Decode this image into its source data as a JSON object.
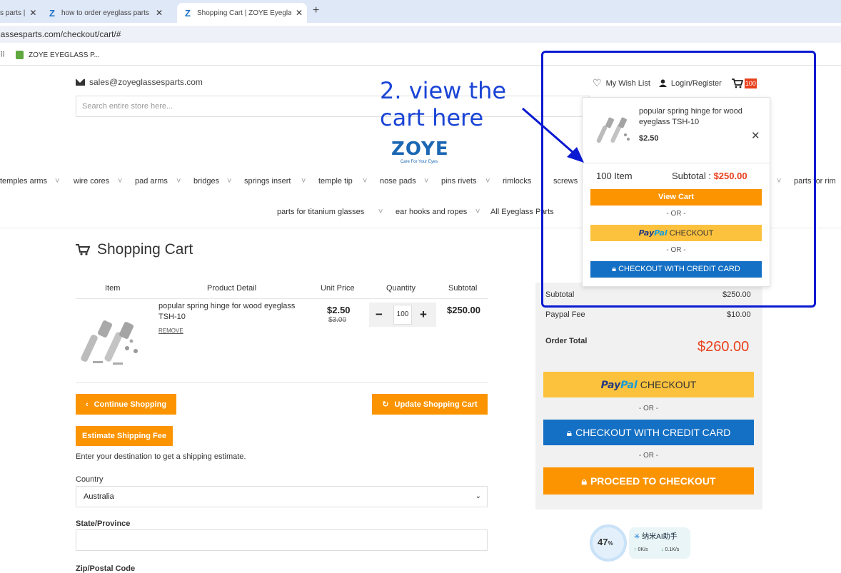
{
  "browser": {
    "tabs": [
      {
        "label": "s parts |"
      },
      {
        "label": "how to order eyeglass parts |"
      },
      {
        "label": "Shopping Cart | ZOYE Eyegla"
      }
    ],
    "url": "lassesparts.com/checkout/cart/#",
    "bookmark_label": "ZOYE EYEGLASS P..."
  },
  "header": {
    "email": "sales@zoyeglassesparts.com",
    "search_placeholder": "Search entire store here...",
    "wishlist": "My Wish List",
    "login": "Login/Register",
    "cart_count": "100",
    "logo_text": "ZOYE",
    "logo_tagline": "Care For Your Eyes"
  },
  "nav": {
    "row1": [
      "temples arms",
      "wire cores",
      "pad arms",
      "bridges",
      "springs insert",
      "temple tip",
      "nose pads",
      "pins rivets",
      "rimlocks",
      "screws",
      "parts for rim"
    ],
    "row2": [
      "parts for titanium glasses",
      "ear hooks and ropes",
      "All Eyeglass Parts"
    ]
  },
  "cart": {
    "title": "Shopping Cart",
    "headers": {
      "item": "Item",
      "detail": "Product Detail",
      "unit_price": "Unit Price",
      "quantity": "Quantity",
      "subtotal": "Subtotal"
    },
    "product": {
      "name": "popular spring hinge for wood eyeglass TSH-10",
      "remove": "REMOVE",
      "price": "$2.50",
      "old_price": "$3.00",
      "qty": "100",
      "subtotal": "$250.00"
    },
    "continue": "Continue Shopping",
    "update": "Update Shopping Cart",
    "estimate": "Estimate Shipping Fee",
    "estimate_note": "Enter your destination to get a shipping estimate.",
    "country_label": "Country",
    "country_value": "Australia",
    "state_label": "State/Province",
    "zip_label": "Zip/Postal Code"
  },
  "summary": {
    "subtotal_label": "Subtotal",
    "subtotal_value": "$250.00",
    "fee_label": "Paypal Fee",
    "fee_value": "$10.00",
    "total_label": "Order Total",
    "total_value": "$260.00",
    "paypal_b": "Pay",
    "paypal_l": "Pal",
    "paypal_checkout": "CHECKOUT",
    "or": "- OR -",
    "credit": "CHECKOUT WITH CREDIT CARD",
    "proceed": "PROCEED TO CHECKOUT"
  },
  "dropdown": {
    "product_name": "popular spring hinge for wood eyeglass TSH-10",
    "price": "$2.50",
    "items": "100 Item",
    "subtotal_label": "Subtotal :",
    "subtotal_value": "$250.00",
    "view_cart": "View Cart",
    "or": "- OR -",
    "paypal_b": "Pay",
    "paypal_l": "Pal",
    "paypal_checkout": "CHECKOUT",
    "credit": "CHECKOUT WITH CREDIT CARD"
  },
  "annotation": {
    "line1": "2. view the",
    "line2": "cart here"
  },
  "widget": {
    "percent": "47",
    "percent_unit": "%",
    "name": "纳米AI助手",
    "up": "0K/s",
    "down": "0.1K/s"
  },
  "colors": {
    "orange": "#fb9400",
    "blue": "#1470c4",
    "yellow": "#fcc23d",
    "red": "#e8401c",
    "annotation": "#0b19d1"
  }
}
